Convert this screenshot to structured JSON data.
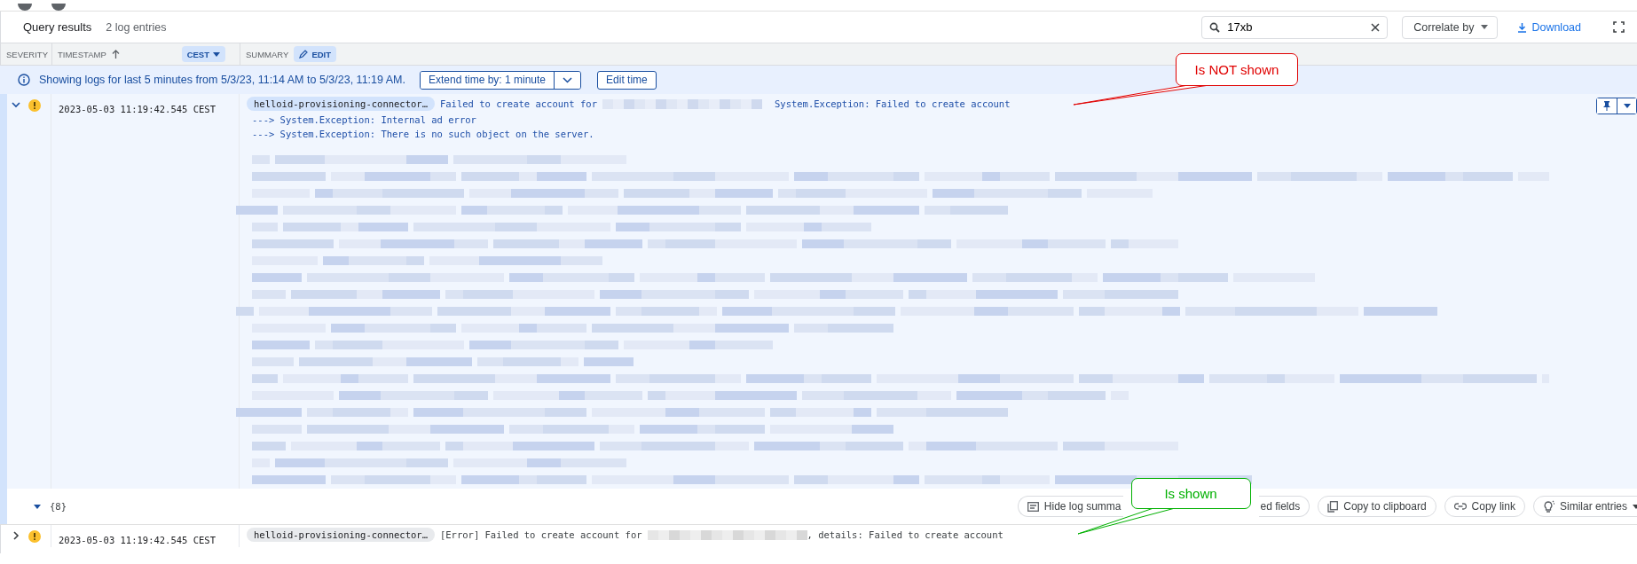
{
  "query_bar": {
    "title": "Query results",
    "count": "2 log entries",
    "search": {
      "value": "17xb"
    },
    "correlate": "Correlate by",
    "download": "Download"
  },
  "columns": {
    "severity": "SEVERITY",
    "timestamp": "TIMESTAMP",
    "timezone": "CEST",
    "summary": "SUMMARY",
    "edit": "EDIT"
  },
  "banner": {
    "text": "Showing logs for last 5 minutes from 5/3/23, 11:14 AM to 5/3/23, 11:19 AM.",
    "extend": "Extend time by: 1 minute",
    "edit_time": "Edit time"
  },
  "entries": [
    {
      "expanded": true,
      "timestamp": "2023-05-03 11:19:42.545 CEST",
      "source": "helloid-provisioning-connector…",
      "message_before": "Failed to create account for",
      "message_after": "System.Exception: Failed to create account",
      "details": [
        "---> System.Exception: Internal ad error",
        "---> System.Exception: There is no such object on the server."
      ],
      "payload": "{8}",
      "actions": [
        {
          "kind": "summary",
          "label": "Hide log summa"
        },
        {
          "kind": "fields",
          "label": "ed fields"
        },
        {
          "kind": "copy",
          "label": "Copy to clipboard"
        },
        {
          "kind": "link",
          "label": "Copy link"
        },
        {
          "kind": "similar",
          "label": "Similar entries"
        }
      ]
    },
    {
      "expanded": false,
      "timestamp": "2023-05-03 11:19:42.545 CEST",
      "source": "helloid-provisioning-connector…",
      "message_before": "[Error] Failed to create account for",
      "message_after": ", details: Failed to create account"
    }
  ],
  "callouts": [
    {
      "text": "Is NOT shown",
      "color": "#e00000"
    },
    {
      "text": "Is shown",
      "color": "#00b000"
    }
  ]
}
